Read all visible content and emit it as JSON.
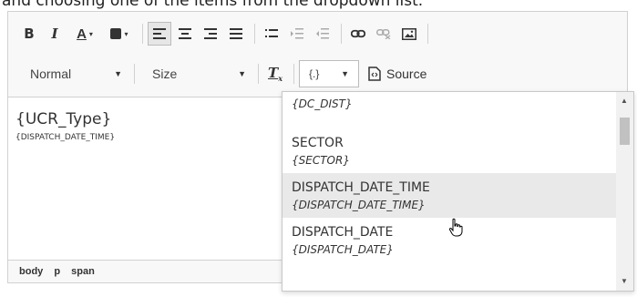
{
  "top_cut_text": "and choosing one of the items from the dropdown list.",
  "toolbar": {
    "bold_label": "B",
    "italic_label": "I",
    "text_color_label": "A",
    "format_combo": "Normal",
    "size_combo": "Size",
    "variable_combo": "{.}",
    "source_label": "Source"
  },
  "content": {
    "line1": "{UCR_Type}",
    "line2": "{DISPATCH_DATE_TIME}"
  },
  "path": [
    "body",
    "p",
    "span"
  ],
  "dropdown": {
    "items": [
      {
        "title": "",
        "code": "{DC_DIST}"
      },
      {
        "title": "SECTOR",
        "code": "{SECTOR}"
      },
      {
        "title": "DISPATCH_DATE_TIME",
        "code": "{DISPATCH_DATE_TIME}"
      },
      {
        "title": "DISPATCH_DATE",
        "code": "{DISPATCH_DATE}"
      }
    ],
    "hovered_index": 2
  },
  "colors": {
    "hover_background": "#e9e9e9",
    "toolbar_background": "#f8f8f8",
    "border": "#d1d1d1"
  }
}
